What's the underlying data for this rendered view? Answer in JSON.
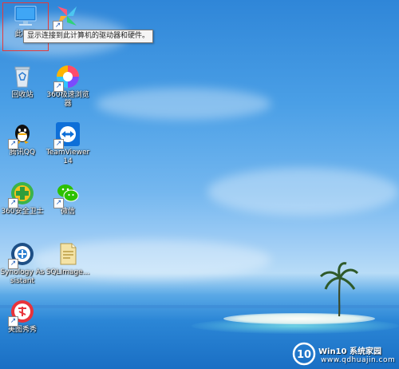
{
  "tooltip": {
    "text": "显示连接到此计算机的驱动器和硬件。"
  },
  "icons": [
    {
      "label": "此电脑",
      "glyph": "computer-icon"
    },
    {
      "label": "",
      "glyph": "flower-app-icon"
    },
    {
      "label": "回收站",
      "glyph": "recycle-bin-icon"
    },
    {
      "label": "360极速浏览器",
      "glyph": "360-browser-icon"
    },
    {
      "label": "腾讯QQ",
      "glyph": "qq-icon"
    },
    {
      "label": "TeamViewer 14",
      "glyph": "teamviewer-icon"
    },
    {
      "label": "360安全卫士",
      "glyph": "360-safe-icon"
    },
    {
      "label": "微信",
      "glyph": "wechat-icon"
    },
    {
      "label": "Synology Assistant",
      "glyph": "synology-icon"
    },
    {
      "label": "SQLImage...",
      "glyph": "file-icon"
    },
    {
      "label": "美图秀秀",
      "glyph": "meitu-icon"
    }
  ],
  "watermark": {
    "title": "Win10 系统家园",
    "domain": "www.qdhuajin.com",
    "logo": "10"
  },
  "colors": {
    "selection": "#e53a3a",
    "sky": "#2f86d8",
    "sea": "#1a6fc4"
  }
}
